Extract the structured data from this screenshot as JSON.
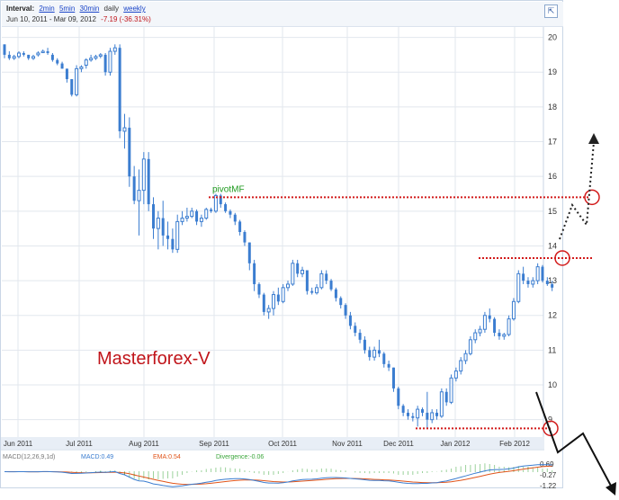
{
  "toolbar": {
    "interval_label": "Interval:",
    "intervals": [
      "2min",
      "5min",
      "30min"
    ],
    "current_interval": "daily",
    "weekly_link": "weekly",
    "date_range": "Jun 10, 2011  -  Mar 09, 2012",
    "change": "-7.19 (-36.31%)",
    "expand_icon": "expand-arrows-icon"
  },
  "chart_data": [
    {
      "type": "candlestick",
      "y_tick_labels": [
        "9",
        "10",
        "11",
        "12",
        "13",
        "14",
        "15",
        "16",
        "17",
        "18",
        "19",
        "20"
      ],
      "ylim": [
        8.5,
        20.3
      ],
      "x_tick_labels": [
        "Jun 2011",
        "Jul 2011",
        "Aug 2011",
        "Sep 2011",
        "Oct 2011",
        "Nov 2011",
        "Dec 2011",
        "Jan 2012",
        "Feb 2012"
      ],
      "annotations": {
        "pivot_label": "pivotMF",
        "pivot_level": 15.4,
        "resistance_level": 13.65,
        "support_level": 8.75,
        "watermark": "Masterforex-V"
      },
      "candles": [
        [
          19.8,
          19.8,
          19.4,
          19.5
        ],
        [
          19.5,
          19.6,
          19.35,
          19.4
        ],
        [
          19.4,
          19.5,
          19.35,
          19.45
        ],
        [
          19.45,
          19.6,
          19.4,
          19.55
        ],
        [
          19.55,
          19.6,
          19.45,
          19.5
        ],
        [
          19.5,
          19.5,
          19.35,
          19.4
        ],
        [
          19.4,
          19.5,
          19.35,
          19.45
        ],
        [
          19.5,
          19.6,
          19.45,
          19.55
        ],
        [
          19.6,
          19.65,
          19.55,
          19.6
        ],
        [
          19.6,
          19.7,
          19.5,
          19.55
        ],
        [
          19.5,
          19.55,
          19.3,
          19.35
        ],
        [
          19.35,
          19.4,
          19.2,
          19.25
        ],
        [
          19.25,
          19.3,
          19.1,
          19.1
        ],
        [
          19.1,
          19.1,
          18.7,
          18.8
        ],
        [
          18.8,
          18.8,
          18.3,
          18.35
        ],
        [
          18.35,
          19.2,
          18.3,
          19.1
        ],
        [
          19.1,
          19.2,
          19.0,
          19.15
        ],
        [
          19.2,
          19.4,
          19.1,
          19.35
        ],
        [
          19.35,
          19.5,
          19.3,
          19.4
        ],
        [
          19.4,
          19.5,
          19.35,
          19.45
        ],
        [
          19.5,
          19.55,
          19.4,
          19.5
        ],
        [
          19.5,
          19.55,
          18.9,
          19.0
        ],
        [
          19.0,
          19.7,
          18.9,
          19.6
        ],
        [
          19.6,
          19.8,
          19.5,
          19.7
        ],
        [
          19.7,
          19.8,
          17.1,
          17.3
        ],
        [
          17.3,
          17.8,
          16.8,
          17.4
        ],
        [
          17.4,
          17.7,
          15.7,
          16.0
        ],
        [
          16.0,
          16.3,
          15.2,
          15.3
        ],
        [
          15.3,
          16.2,
          14.3,
          15.6
        ],
        [
          15.6,
          16.7,
          15.2,
          16.5
        ],
        [
          16.5,
          16.7,
          15.0,
          15.2
        ],
        [
          15.2,
          15.4,
          14.2,
          14.5
        ],
        [
          14.5,
          15.0,
          13.9,
          14.8
        ],
        [
          14.8,
          15.3,
          14.0,
          14.3
        ],
        [
          14.3,
          14.7,
          13.9,
          14.2
        ],
        [
          14.2,
          14.5,
          13.8,
          13.9
        ],
        [
          13.9,
          14.9,
          13.8,
          14.7
        ],
        [
          14.7,
          15.0,
          14.6,
          14.8
        ],
        [
          14.8,
          15.1,
          14.7,
          14.85
        ],
        [
          14.85,
          15.1,
          14.8,
          15.0
        ],
        [
          15.0,
          15.05,
          14.6,
          14.7
        ],
        [
          14.7,
          14.9,
          14.55,
          14.8
        ],
        [
          14.8,
          15.1,
          14.75,
          15.05
        ],
        [
          15.05,
          15.1,
          14.95,
          15.0
        ],
        [
          15.0,
          15.5,
          14.95,
          15.45
        ],
        [
          15.45,
          15.5,
          15.1,
          15.2
        ],
        [
          15.2,
          15.25,
          14.95,
          15.0
        ],
        [
          15.0,
          15.05,
          14.8,
          14.9
        ],
        [
          14.9,
          14.95,
          14.6,
          14.7
        ],
        [
          14.7,
          14.75,
          14.3,
          14.4
        ],
        [
          14.4,
          14.45,
          14.0,
          14.1
        ],
        [
          14.1,
          14.1,
          13.3,
          13.5
        ],
        [
          13.5,
          13.6,
          12.7,
          12.9
        ],
        [
          12.9,
          12.95,
          12.5,
          12.6
        ],
        [
          12.6,
          12.65,
          12.0,
          12.1
        ],
        [
          12.1,
          12.3,
          11.9,
          12.2
        ],
        [
          12.2,
          12.7,
          12.0,
          12.6
        ],
        [
          12.6,
          12.8,
          12.3,
          12.4
        ],
        [
          12.4,
          12.9,
          12.35,
          12.8
        ],
        [
          12.8,
          13.0,
          12.7,
          12.9
        ],
        [
          12.9,
          13.6,
          12.85,
          13.5
        ],
        [
          13.5,
          13.6,
          13.1,
          13.2
        ],
        [
          13.2,
          13.4,
          13.1,
          13.3
        ],
        [
          13.3,
          13.3,
          12.6,
          12.7
        ],
        [
          12.7,
          12.8,
          12.6,
          12.65
        ],
        [
          12.65,
          12.9,
          12.6,
          12.8
        ],
        [
          12.8,
          13.3,
          12.75,
          13.2
        ],
        [
          13.2,
          13.3,
          12.9,
          13.0
        ],
        [
          13.0,
          13.05,
          12.7,
          12.75
        ],
        [
          12.75,
          12.8,
          12.4,
          12.5
        ],
        [
          12.5,
          12.55,
          12.2,
          12.3
        ],
        [
          12.3,
          12.35,
          11.9,
          12.0
        ],
        [
          12.0,
          12.1,
          11.6,
          11.7
        ],
        [
          11.7,
          11.8,
          11.4,
          11.5
        ],
        [
          11.5,
          11.6,
          11.2,
          11.3
        ],
        [
          11.3,
          11.4,
          10.9,
          11.0
        ],
        [
          11.0,
          11.1,
          10.7,
          10.8
        ],
        [
          10.8,
          11.1,
          10.7,
          11.0
        ],
        [
          11.0,
          11.3,
          10.8,
          10.9
        ],
        [
          10.9,
          10.95,
          10.5,
          10.6
        ],
        [
          10.6,
          10.7,
          10.4,
          10.5
        ],
        [
          10.5,
          10.5,
          9.8,
          9.9
        ],
        [
          9.9,
          9.95,
          9.3,
          9.4
        ],
        [
          9.4,
          9.45,
          9.1,
          9.2
        ],
        [
          9.2,
          9.3,
          9.0,
          9.1
        ],
        [
          9.1,
          9.2,
          8.95,
          9.05
        ],
        [
          9.05,
          9.4,
          8.8,
          9.3
        ],
        [
          9.3,
          9.35,
          9.1,
          9.2
        ],
        [
          9.2,
          9.8,
          8.75,
          9.0
        ],
        [
          9.0,
          9.3,
          8.9,
          9.2
        ],
        [
          9.2,
          9.3,
          9.0,
          9.1
        ],
        [
          9.1,
          9.9,
          9.05,
          9.8
        ],
        [
          9.8,
          9.9,
          9.4,
          9.5
        ],
        [
          9.5,
          10.3,
          9.45,
          10.2
        ],
        [
          10.2,
          10.5,
          10.1,
          10.4
        ],
        [
          10.4,
          10.8,
          10.3,
          10.7
        ],
        [
          10.7,
          11.0,
          10.6,
          10.9
        ],
        [
          10.9,
          11.4,
          10.85,
          11.3
        ],
        [
          11.3,
          11.6,
          11.2,
          11.5
        ],
        [
          11.5,
          11.7,
          11.4,
          11.6
        ],
        [
          11.6,
          12.1,
          11.5,
          12.0
        ],
        [
          12.0,
          12.2,
          11.8,
          11.9
        ],
        [
          11.9,
          11.95,
          11.4,
          11.5
        ],
        [
          11.5,
          11.6,
          11.3,
          11.4
        ],
        [
          11.4,
          11.5,
          11.3,
          11.45
        ],
        [
          11.45,
          12.0,
          11.4,
          11.9
        ],
        [
          11.9,
          12.5,
          11.85,
          12.4
        ],
        [
          12.4,
          13.3,
          12.35,
          13.2
        ],
        [
          13.2,
          13.4,
          12.9,
          13.0
        ],
        [
          13.0,
          13.1,
          12.8,
          12.9
        ],
        [
          12.9,
          13.1,
          12.8,
          13.0
        ],
        [
          13.0,
          13.5,
          12.9,
          13.4
        ],
        [
          13.4,
          13.45,
          12.95,
          13.0
        ],
        [
          13.0,
          13.1,
          12.85,
          12.9
        ],
        [
          12.9,
          13.0,
          12.7,
          12.8
        ]
      ]
    },
    {
      "type": "macd",
      "title": "MACD(12,26,9,1d)",
      "macd_label": "MACD:0.49",
      "ema_label": "EMA:0.54",
      "divergence_label": "Divergence:-0.06",
      "y_tick_labels": [
        "0.69",
        "-0.27",
        "-1.22"
      ],
      "ylim": [
        -1.4,
        1.0
      ]
    }
  ],
  "colors": {
    "candle": "#3b7dd0",
    "grid": "#e2e7ee",
    "pivot_line": "#d21b1b",
    "pivot_text": "#1f9a1f",
    "watermark": "#c0141a",
    "macd_line": "#3b7dd0",
    "ema_line": "#e0541a",
    "histogram": "#3aa63a"
  }
}
